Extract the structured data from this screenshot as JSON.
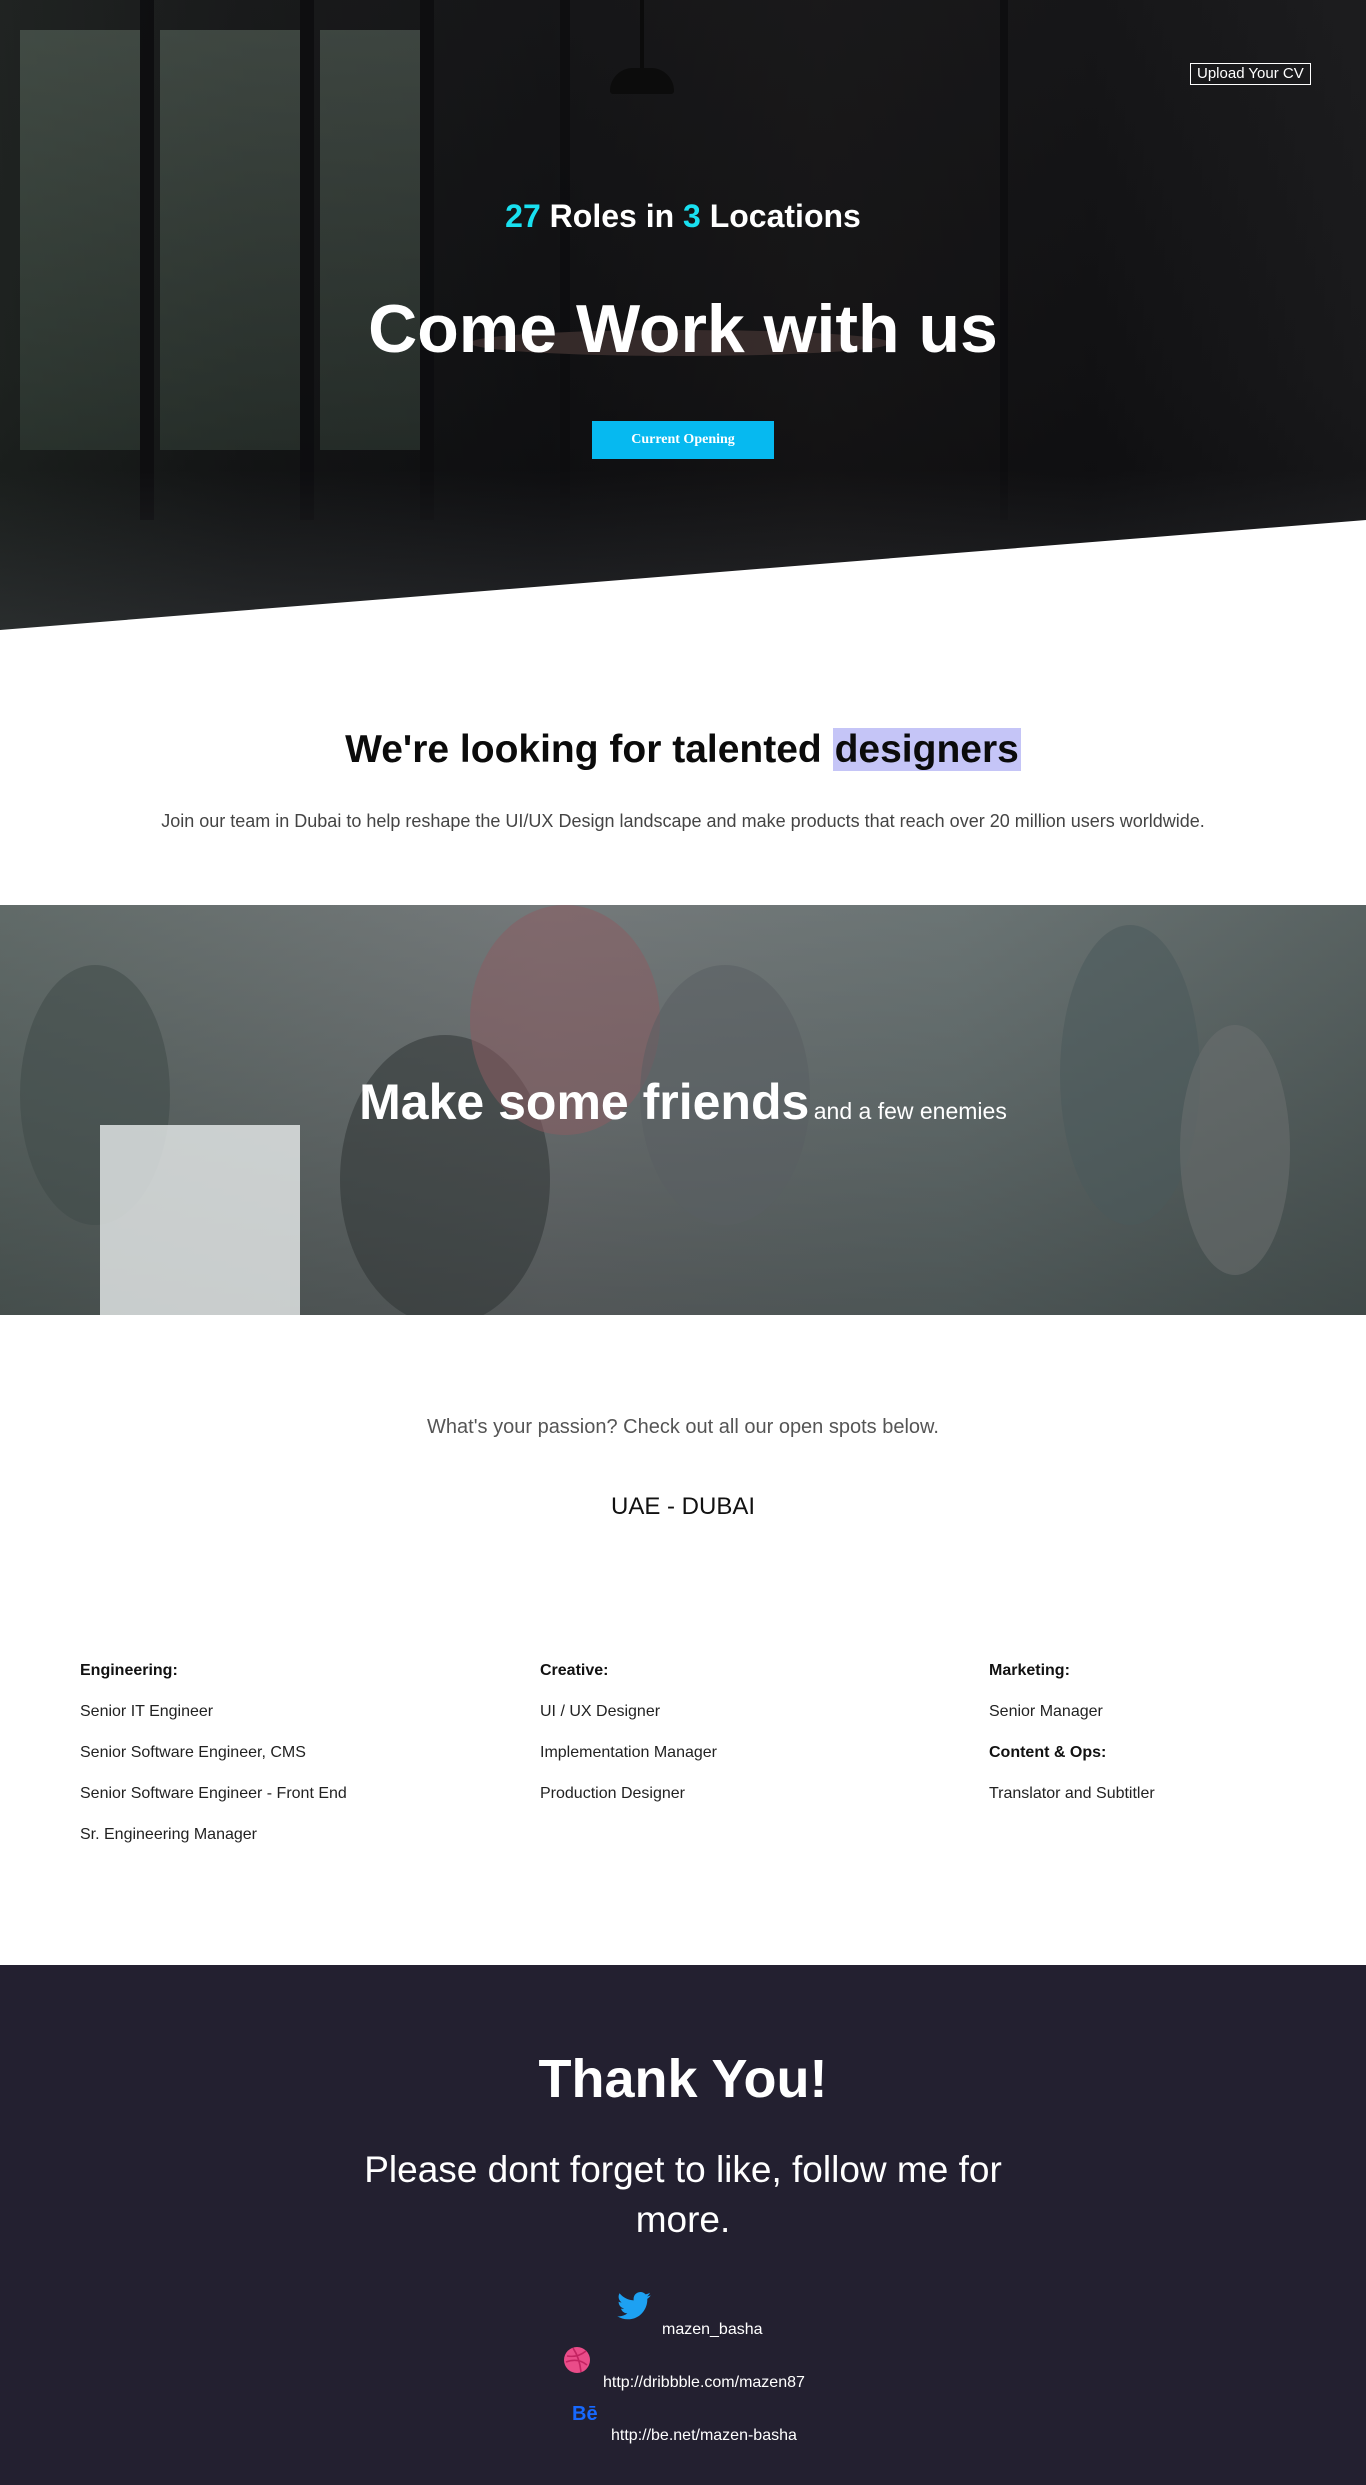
{
  "hero": {
    "upload_cv": "Upload Your CV",
    "roles_count": "27",
    "roles_text": " Roles in ",
    "locations_count": "3",
    "locations_text": " Locations",
    "title": "Come Work with us",
    "cta": "Current Opening"
  },
  "talent": {
    "title_prefix": "We're looking for talented ",
    "title_highlight": "designers",
    "subtitle": "Join our team in Dubai to help reshape the UI/UX Design landscape and make products that reach over 20 million users worldwide."
  },
  "friends": {
    "big": "Make some friends",
    "small": "and a few enemies"
  },
  "positions": {
    "passion": "What's your passion? Check out all our open spots below.",
    "location": "UAE - DUBAI",
    "engineering": {
      "heading": "Engineering:",
      "jobs": [
        "Senior IT Engineer",
        "Senior Software Engineer, CMS",
        "Senior Software Engineer - Front End",
        "Sr. Engineering Manager"
      ]
    },
    "creative": {
      "heading": "Creative:",
      "jobs": [
        "UI / UX Designer",
        "Implementation Manager",
        "Production Designer"
      ]
    },
    "marketing": {
      "heading": "Marketing:",
      "jobs": [
        "Senior Manager"
      ]
    },
    "content": {
      "heading": "Content & Ops:",
      "jobs": [
        "Translator and Subtitler"
      ]
    }
  },
  "footer": {
    "thanks": "Thank You!",
    "follow": "Please dont forget to like, follow me for more.",
    "twitter": "mazen_basha",
    "dribbble": "http://dribbble.com/mazen87",
    "behance": "http://be.net/mazen-basha",
    "behance_icon_text": "Bē",
    "icons": [
      "twitter-icon",
      "dribbble-icon",
      "behance-icon"
    ]
  },
  "colors": {
    "accent_cyan": "#19e0f0",
    "button_blue": "#06b9f0",
    "highlight": "#c5c5f7",
    "footer_bg": "#232030",
    "twitter": "#1da1f2",
    "dribbble": "#ea4c89",
    "behance": "#1769ff"
  }
}
